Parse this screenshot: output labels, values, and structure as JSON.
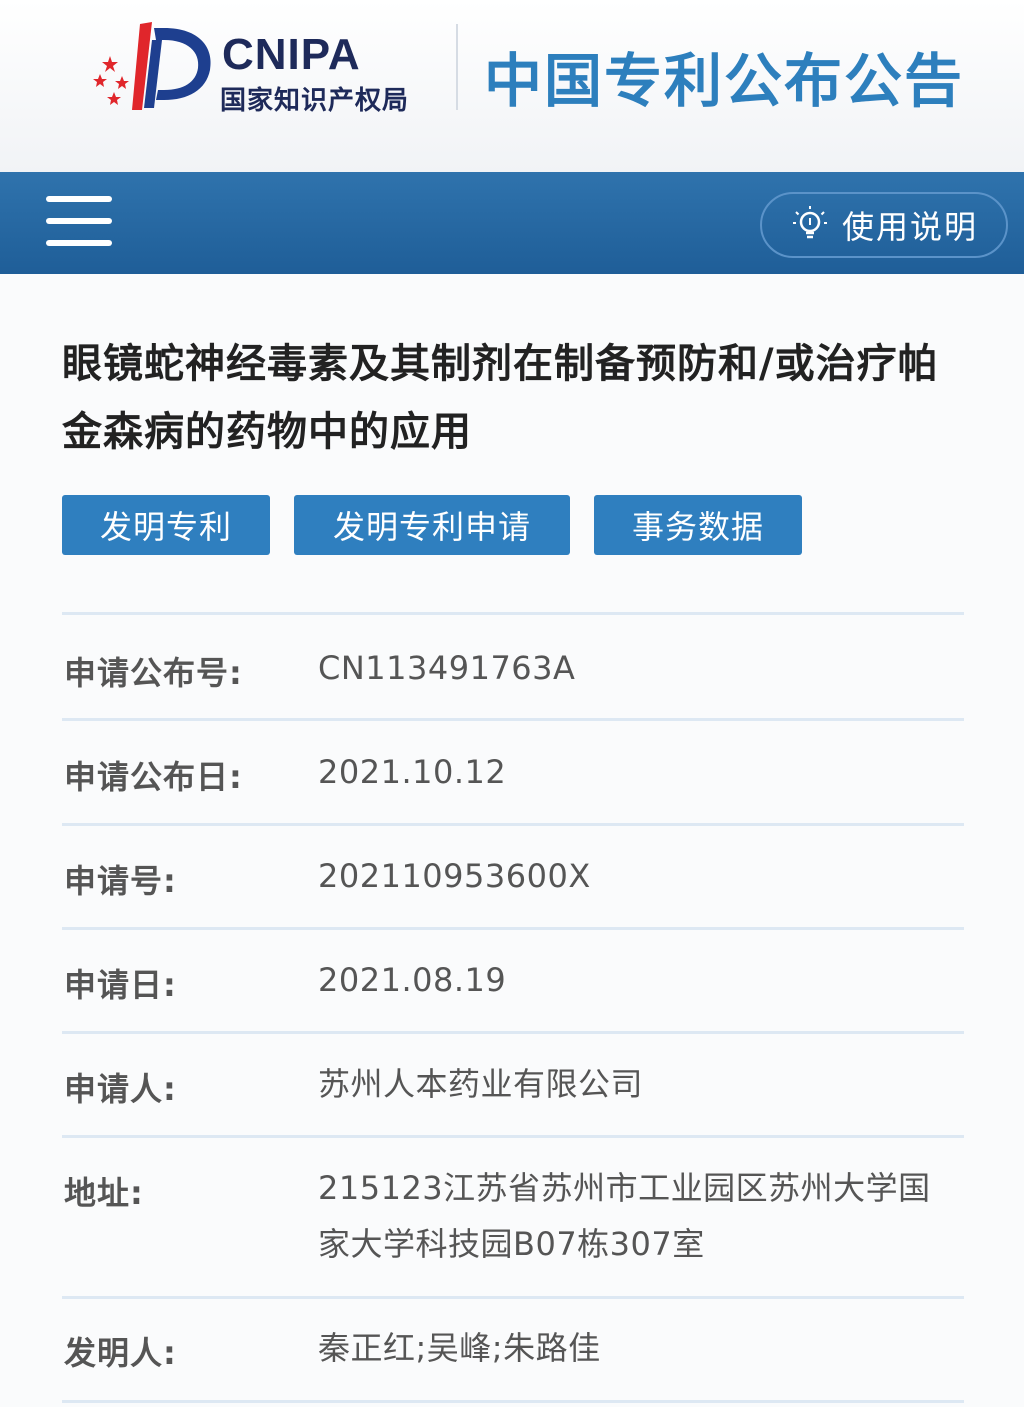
{
  "header": {
    "logo_en": "CNIPA",
    "logo_cn": "国家知识产权局",
    "site_title": "中国专利公布公告"
  },
  "navbar": {
    "menu_icon": "hamburger-menu-icon",
    "help_icon": "lightbulb-icon",
    "help_label": "使用说明"
  },
  "patent": {
    "title": "眼镜蛇神经毒素及其制剂在制备预防和/或治疗帕金森病的药物中的应用",
    "tags": [
      "发明专利",
      "发明专利申请",
      "事务数据"
    ],
    "fields": [
      {
        "label": "申请公布号:",
        "value": "CN113491763A"
      },
      {
        "label": "申请公布日:",
        "value": "2021.10.12"
      },
      {
        "label": "申请号:",
        "value": "202110953600X"
      },
      {
        "label": "申请日:",
        "value": "2021.08.19"
      },
      {
        "label": "申请人:",
        "value": "苏州人本药业有限公司"
      },
      {
        "label": "地址:",
        "value": "215123江苏省苏州市工业园区苏州大学国家大学科技园B07栋307室"
      },
      {
        "label": "发明人:",
        "value": "秦正红;吴峰;朱路佳"
      }
    ]
  },
  "colors": {
    "brand_blue": "#2d7fbd",
    "navbar_blue": "#1f5e98",
    "tag_blue": "#2f7fbf",
    "logo_red": "#e0262b",
    "logo_navy": "#1e2a5a"
  }
}
